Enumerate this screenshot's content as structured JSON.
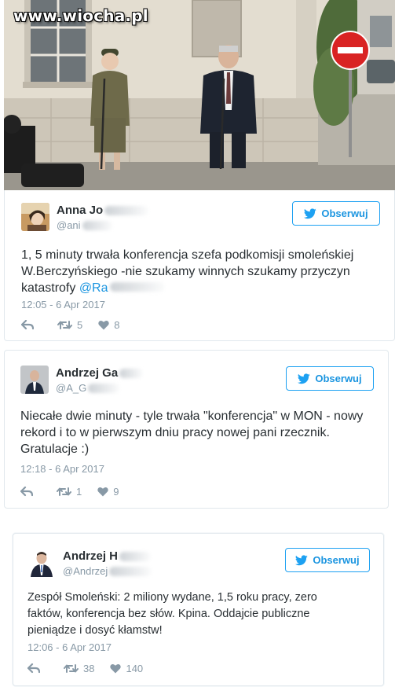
{
  "photo": {
    "watermark": "www.wiocha.pl"
  },
  "tweets": [
    {
      "name": "Anna Jo",
      "handle": "@ani",
      "follow_label": "Obserwuj",
      "text_line1": "1, 5 minuty trwała konferencja szefa podkomisji smoleńskiej",
      "text_line2": "W.Berczyńskiego -nie szukamy winnych szukamy przyczyn",
      "text_line3": "katastrofy ",
      "mention": "@Ra",
      "date": "12:05 - 6 Apr 2017",
      "retweets": "5",
      "likes": "8"
    },
    {
      "name": "Andrzej Ga",
      "handle": "@A_G",
      "follow_label": "Obserwuj",
      "text_line1": "Niecałe dwie minuty - tyle trwała \"konferencja\" w MON - nowy",
      "text_line2": "rekord i to w pierwszym dniu pracy nowej pani rzecznik.",
      "text_line3": "Gratulacje :)",
      "date": "12:18 - 6 Apr 2017",
      "retweets": "1",
      "likes": "9"
    },
    {
      "name": "Andrzej H",
      "handle": "@Andrzej",
      "follow_label": "Obserwuj",
      "text_line1": "Zespół Smoleński: 2 miliony wydane, 1,5 roku pracy, zero",
      "text_line2": "faktów, konferencja bez słów. Kpina. Oddajcie publiczne",
      "text_line3": "pieniądze i dosyć kłamstw!",
      "date": "12:06 - 6 Apr 2017",
      "retweets": "38",
      "likes": "140"
    }
  ],
  "colors": {
    "accent": "#1da1f2",
    "muted": "#8899a6",
    "text": "#292f33",
    "border": "#e1e8ed"
  },
  "icons": [
    "twitter-bird-icon",
    "reply-icon",
    "retweet-icon",
    "heart-icon",
    "no-entry-sign-icon"
  ]
}
